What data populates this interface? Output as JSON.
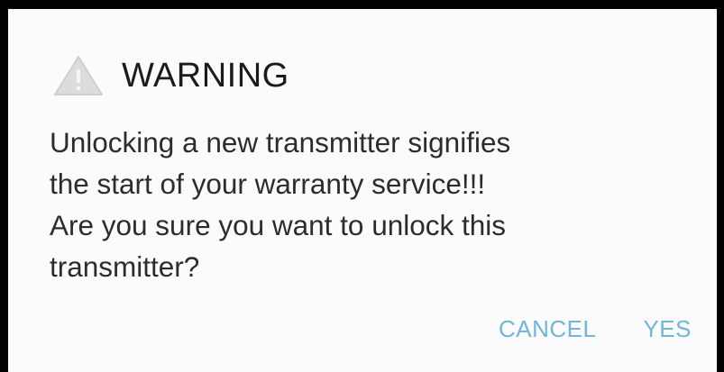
{
  "dialog": {
    "icon": "warning-triangle-icon",
    "title": "WARNING",
    "message_lines": [
      "Unlocking a new transmitter signifies",
      "the start of your warranty service!!!",
      "Are you sure you want to unlock this",
      "transmitter?"
    ],
    "cancel_label": "CANCEL",
    "confirm_label": "YES"
  },
  "colors": {
    "frame": "#000000",
    "dialog_background": "#fbfbfb",
    "title_text": "#1b1b1b",
    "body_text": "#2c2c2c",
    "action_text": "#6fb7da",
    "icon": "#d9d9d9"
  }
}
